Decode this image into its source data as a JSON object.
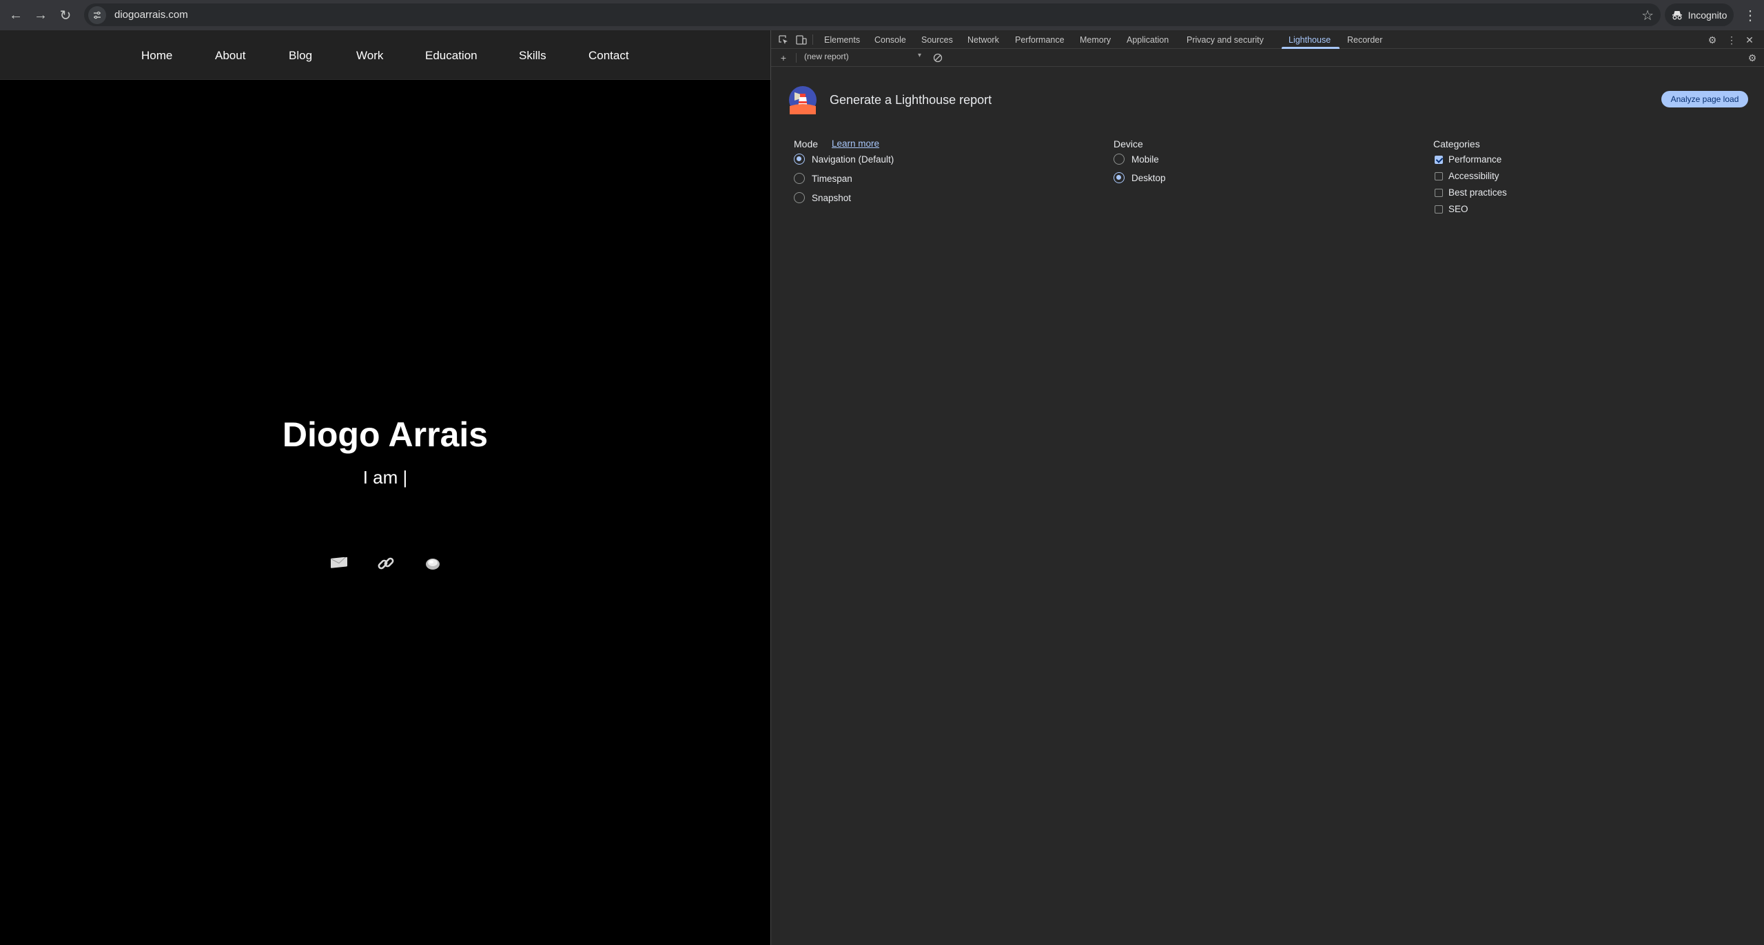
{
  "browser": {
    "url": "diogoarrais.com",
    "profile_label": "Incognito",
    "icons": [
      "back-arrow-icon",
      "forward-arrow-icon",
      "reload-icon",
      "site-settings-icon",
      "bookmark-star-icon",
      "incognito-icon",
      "more-menu-icon"
    ]
  },
  "site": {
    "nav": [
      "Home",
      "About",
      "Blog",
      "Work",
      "Education",
      "Skills",
      "Contact"
    ],
    "name": "Diogo Arrais",
    "subtitle": "I am |",
    "social_icons": [
      "email-icon",
      "link-icon",
      "github-icon"
    ]
  },
  "devtools": {
    "tabs": [
      "Elements",
      "Console",
      "Sources",
      "Network",
      "Performance",
      "Memory",
      "Application",
      "Privacy and security",
      "Lighthouse",
      "Recorder"
    ],
    "active_tab": "Lighthouse",
    "report_select": "(new report)",
    "lighthouse": {
      "title": "Generate a Lighthouse report",
      "analyze_button": "Analyze page load",
      "mode_label": "Mode",
      "learn_more": "Learn more",
      "modes": [
        {
          "label": "Navigation (Default)",
          "selected": true
        },
        {
          "label": "Timespan",
          "selected": false
        },
        {
          "label": "Snapshot",
          "selected": false
        }
      ],
      "device_label": "Device",
      "devices": [
        {
          "label": "Mobile",
          "selected": false
        },
        {
          "label": "Desktop",
          "selected": true
        }
      ],
      "categories_label": "Categories",
      "categories": [
        {
          "label": "Performance",
          "checked": true
        },
        {
          "label": "Accessibility",
          "checked": false
        },
        {
          "label": "Best practices",
          "checked": false
        },
        {
          "label": "SEO",
          "checked": false
        }
      ]
    },
    "accent_color": "#a8c7fa"
  }
}
